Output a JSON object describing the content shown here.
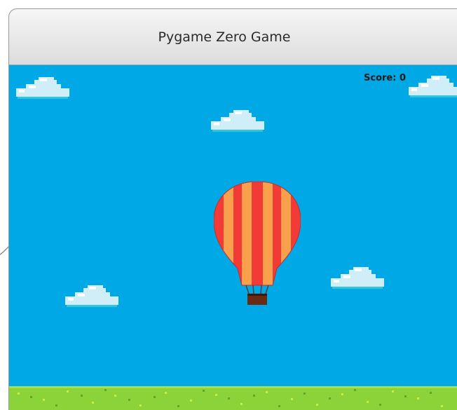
{
  "window": {
    "title": "Pygame Zero Game"
  },
  "game": {
    "score_text": "Score: 0",
    "sprites": {
      "player": "hot-air-balloon",
      "obstacles": [
        "cloud",
        "cloud",
        "cloud",
        "cloud",
        "cloud"
      ],
      "terrain": "grass"
    },
    "colors": {
      "sky": "#00a8e6",
      "balloon_red": "#f23b36",
      "balloon_orange": "#f9a04c",
      "cloud": "#d6f1f8",
      "grass": "#8cd33a"
    }
  }
}
